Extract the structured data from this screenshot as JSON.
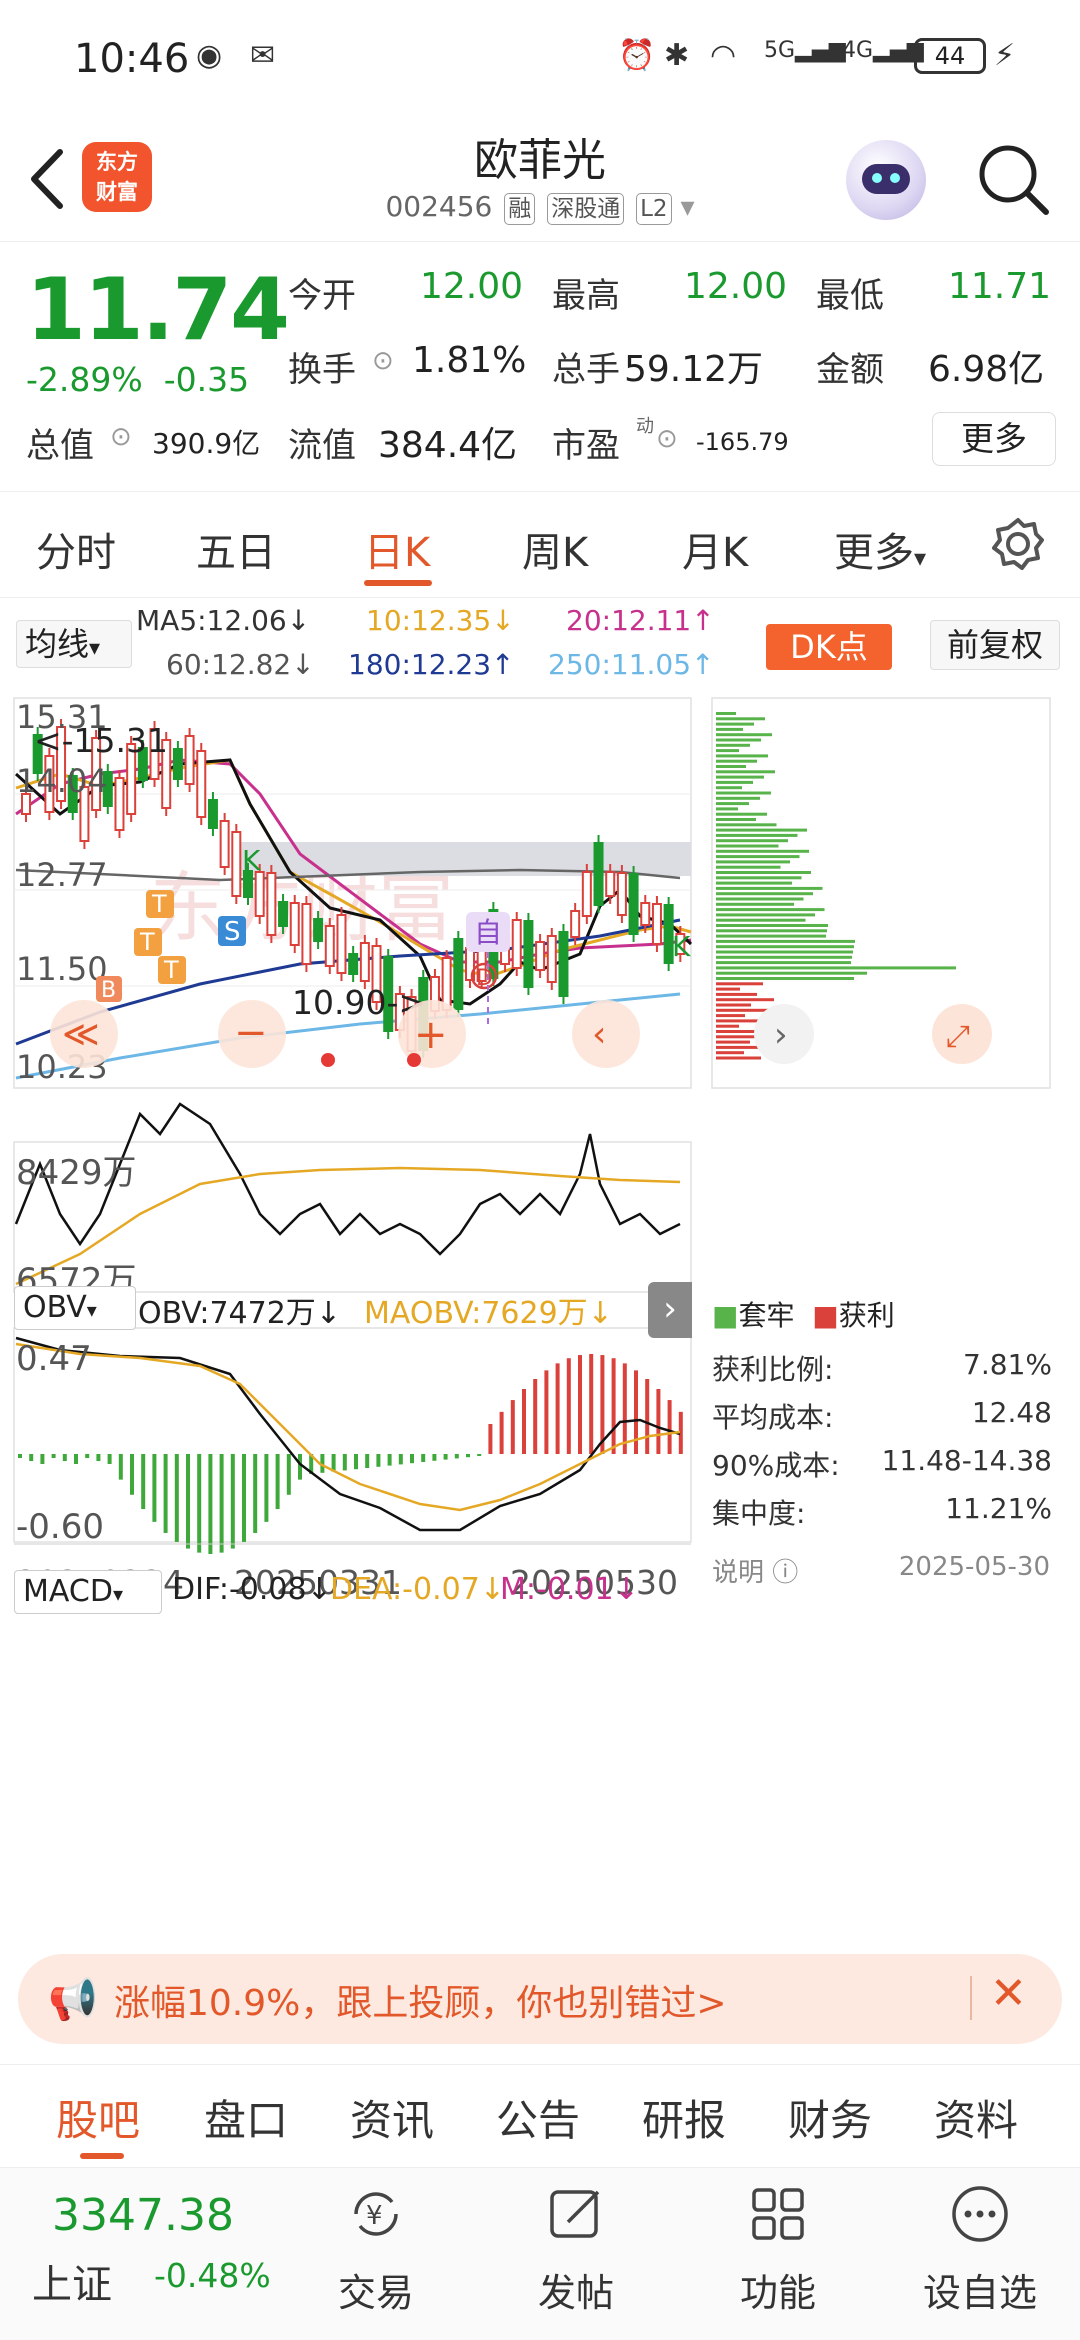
{
  "status": {
    "time": "10:46",
    "battery": "44"
  },
  "header": {
    "name": "欧菲光",
    "code": "002456",
    "tags": [
      "融",
      "深股通",
      "L2"
    ],
    "logo_line1": "东方",
    "logo_line2": "财富"
  },
  "quote": {
    "price": "11.74",
    "change_pct": "-2.89%",
    "change": "-0.35",
    "open_label": "今开",
    "open": "12.00",
    "high_label": "最高",
    "high": "12.00",
    "low_label": "最低",
    "low": "11.71",
    "turnover_label": "换手",
    "turnover": "1.81%",
    "volume_label": "总手",
    "volume": "59.12万",
    "amount_label": "金额",
    "amount": "6.98亿",
    "mcap_label": "总值",
    "mcap": "390.9亿",
    "float_label": "流值",
    "float": "384.4亿",
    "pe_label": "市盈",
    "pe_sup": "动",
    "pe": "-165.79",
    "more": "更多"
  },
  "tabs": [
    "分时",
    "五日",
    "日K",
    "周K",
    "月K",
    "更多"
  ],
  "ma": {
    "button": "均线",
    "ma5": "MA5:12.06↓",
    "ma10": "10:12.35↓",
    "ma20": "20:12.11↑",
    "ma60": "60:12.82↓",
    "ma180": "180:12.23↑",
    "ma250": "250:11.05↑",
    "dk": "DK点",
    "fq": "前复权"
  },
  "kline": {
    "y_labels": [
      "15.31",
      "14.04",
      "12.77",
      "11.50",
      "10.23"
    ],
    "high_note": "<-15.31",
    "low_note": "10.90->",
    "zi": "自",
    "s_mark": "S",
    "b_mark": "B",
    "t_mark": "T",
    "k_mark": "K",
    "d_mark": "D",
    "watermark": "东方财富"
  },
  "obv": {
    "button": "OBV",
    "obv": "OBV:7472万↓",
    "maobv": "MAOBV:7629万↓",
    "y_top": "8429万",
    "y_bottom": "6572万"
  },
  "macd": {
    "button": "MACD",
    "dif": "DIF:-0.08↓",
    "dea": "DEA:-0.07↓",
    "m": "M:-0.01↓",
    "y_top": "0.47",
    "y_bottom": "-0.60"
  },
  "dates": [
    "20250224",
    "20250331",
    "20250530"
  ],
  "chip": {
    "legend_a": "套牢",
    "legend_b": "获利",
    "rows": [
      {
        "k": "获利比例:",
        "v": "7.81%"
      },
      {
        "k": "平均成本:",
        "v": "12.48"
      },
      {
        "k": "90%成本:",
        "v": "11.48-14.38"
      },
      {
        "k": "集中度:",
        "v": "11.21%"
      }
    ],
    "note": "说明",
    "date": "2025-05-30"
  },
  "banner": {
    "text": "涨幅10.9%，跟上投顾，你也别错过>"
  },
  "subtabs": [
    "股吧",
    "盘口",
    "资讯",
    "公告",
    "研报",
    "财务",
    "资料"
  ],
  "bottom_nav": {
    "index_value": "3347.38",
    "index_name": "上证",
    "index_chg": "-0.48%",
    "items": [
      "交易",
      "发帖",
      "功能",
      "设自选"
    ]
  },
  "colors": {
    "up": "#d9413a",
    "down": "#1a9a2e",
    "accent": "#e2582a"
  }
}
